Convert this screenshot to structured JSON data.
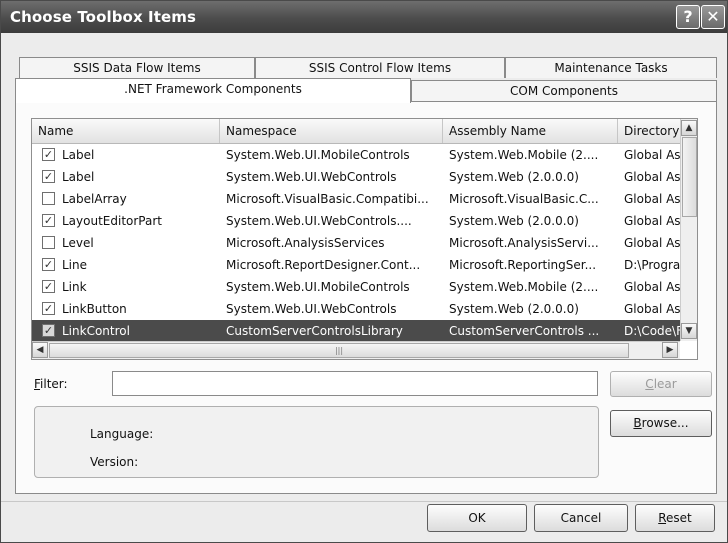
{
  "window": {
    "title": "Choose Toolbox Items",
    "help_glyph": "?",
    "close_glyph": "✕"
  },
  "tabs_back": [
    "SSIS Data Flow Items",
    "SSIS Control Flow Items",
    "Maintenance Tasks"
  ],
  "tabs_front": [
    ".NET Framework Components",
    "COM Components"
  ],
  "columns": [
    "Name",
    "Namespace",
    "Assembly Name",
    "Directory"
  ],
  "rows": [
    {
      "checked": true,
      "name": "Label",
      "namespace": "System.Web.UI.MobileControls",
      "assembly": "System.Web.Mobile (2....",
      "directory": "Global Ass"
    },
    {
      "checked": true,
      "name": "Label",
      "namespace": "System.Web.UI.WebControls",
      "assembly": "System.Web (2.0.0.0)",
      "directory": "Global Ass"
    },
    {
      "checked": false,
      "name": "LabelArray",
      "namespace": "Microsoft.VisualBasic.Compatibi...",
      "assembly": "Microsoft.VisualBasic.C...",
      "directory": "Global Ass"
    },
    {
      "checked": true,
      "name": "LayoutEditorPart",
      "namespace": "System.Web.UI.WebControls....",
      "assembly": "System.Web (2.0.0.0)",
      "directory": "Global Ass"
    },
    {
      "checked": false,
      "name": "Level",
      "namespace": "Microsoft.AnalysisServices",
      "assembly": "Microsoft.AnalysisServi...",
      "directory": "Global Ass"
    },
    {
      "checked": true,
      "name": "Line",
      "namespace": "Microsoft.ReportDesigner.Cont...",
      "assembly": "Microsoft.ReportingSer...",
      "directory": "D:\\Progra"
    },
    {
      "checked": true,
      "name": "Link",
      "namespace": "System.Web.UI.MobileControls",
      "assembly": "System.Web.Mobile (2....",
      "directory": "Global Ass"
    },
    {
      "checked": true,
      "name": "LinkButton",
      "namespace": "System.Web.UI.WebControls",
      "assembly": "System.Web (2.0.0.0)",
      "directory": "Global Ass"
    },
    {
      "checked": true,
      "name": "LinkControl",
      "namespace": "CustomServerControlsLibrary",
      "assembly": "CustomServerControls ...",
      "directory": "D:\\Code\\F"
    }
  ],
  "selected_row": 8,
  "filter": {
    "label": "Filter:",
    "value": "",
    "clear_label": "Clear"
  },
  "info": {
    "language_label": "Language:",
    "version_label": "Version:",
    "browse_label": "Browse..."
  },
  "footer": {
    "ok_label": "OK",
    "cancel_label": "Cancel",
    "reset_label": "Reset"
  },
  "glyphs": {
    "check": "✓",
    "up": "▲",
    "down": "▼",
    "left": "◀",
    "right": "▶",
    "grip": "|||"
  }
}
